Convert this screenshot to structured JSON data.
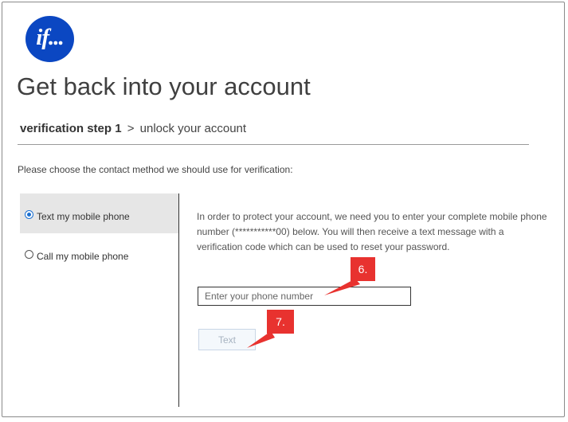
{
  "logo": {
    "text": "if..."
  },
  "header": {
    "title": "Get back into your account",
    "breadcrumb": {
      "current_step": "verification step 1",
      "separator": ">",
      "next_step": "unlock your account"
    }
  },
  "instruction": "Please choose the contact method we should use for verification:",
  "methods": [
    {
      "label": "Text my mobile phone",
      "selected": true
    },
    {
      "label": "Call my mobile phone",
      "selected": false
    }
  ],
  "panel": {
    "info": "In order to protect your account, we need you to enter your complete mobile phone number (***********00) below. You will then receive a text message with a verification code which can be used to reset your password.",
    "phone_input": {
      "placeholder": "Enter your phone number",
      "value": ""
    },
    "submit_label": "Text"
  },
  "annotations": [
    {
      "label": "6."
    },
    {
      "label": "7."
    }
  ],
  "colors": {
    "logo": "#0b47c2",
    "callout": "#e8322f",
    "selected_option": "#e6e6e6",
    "radio": "#1a6fd1"
  }
}
